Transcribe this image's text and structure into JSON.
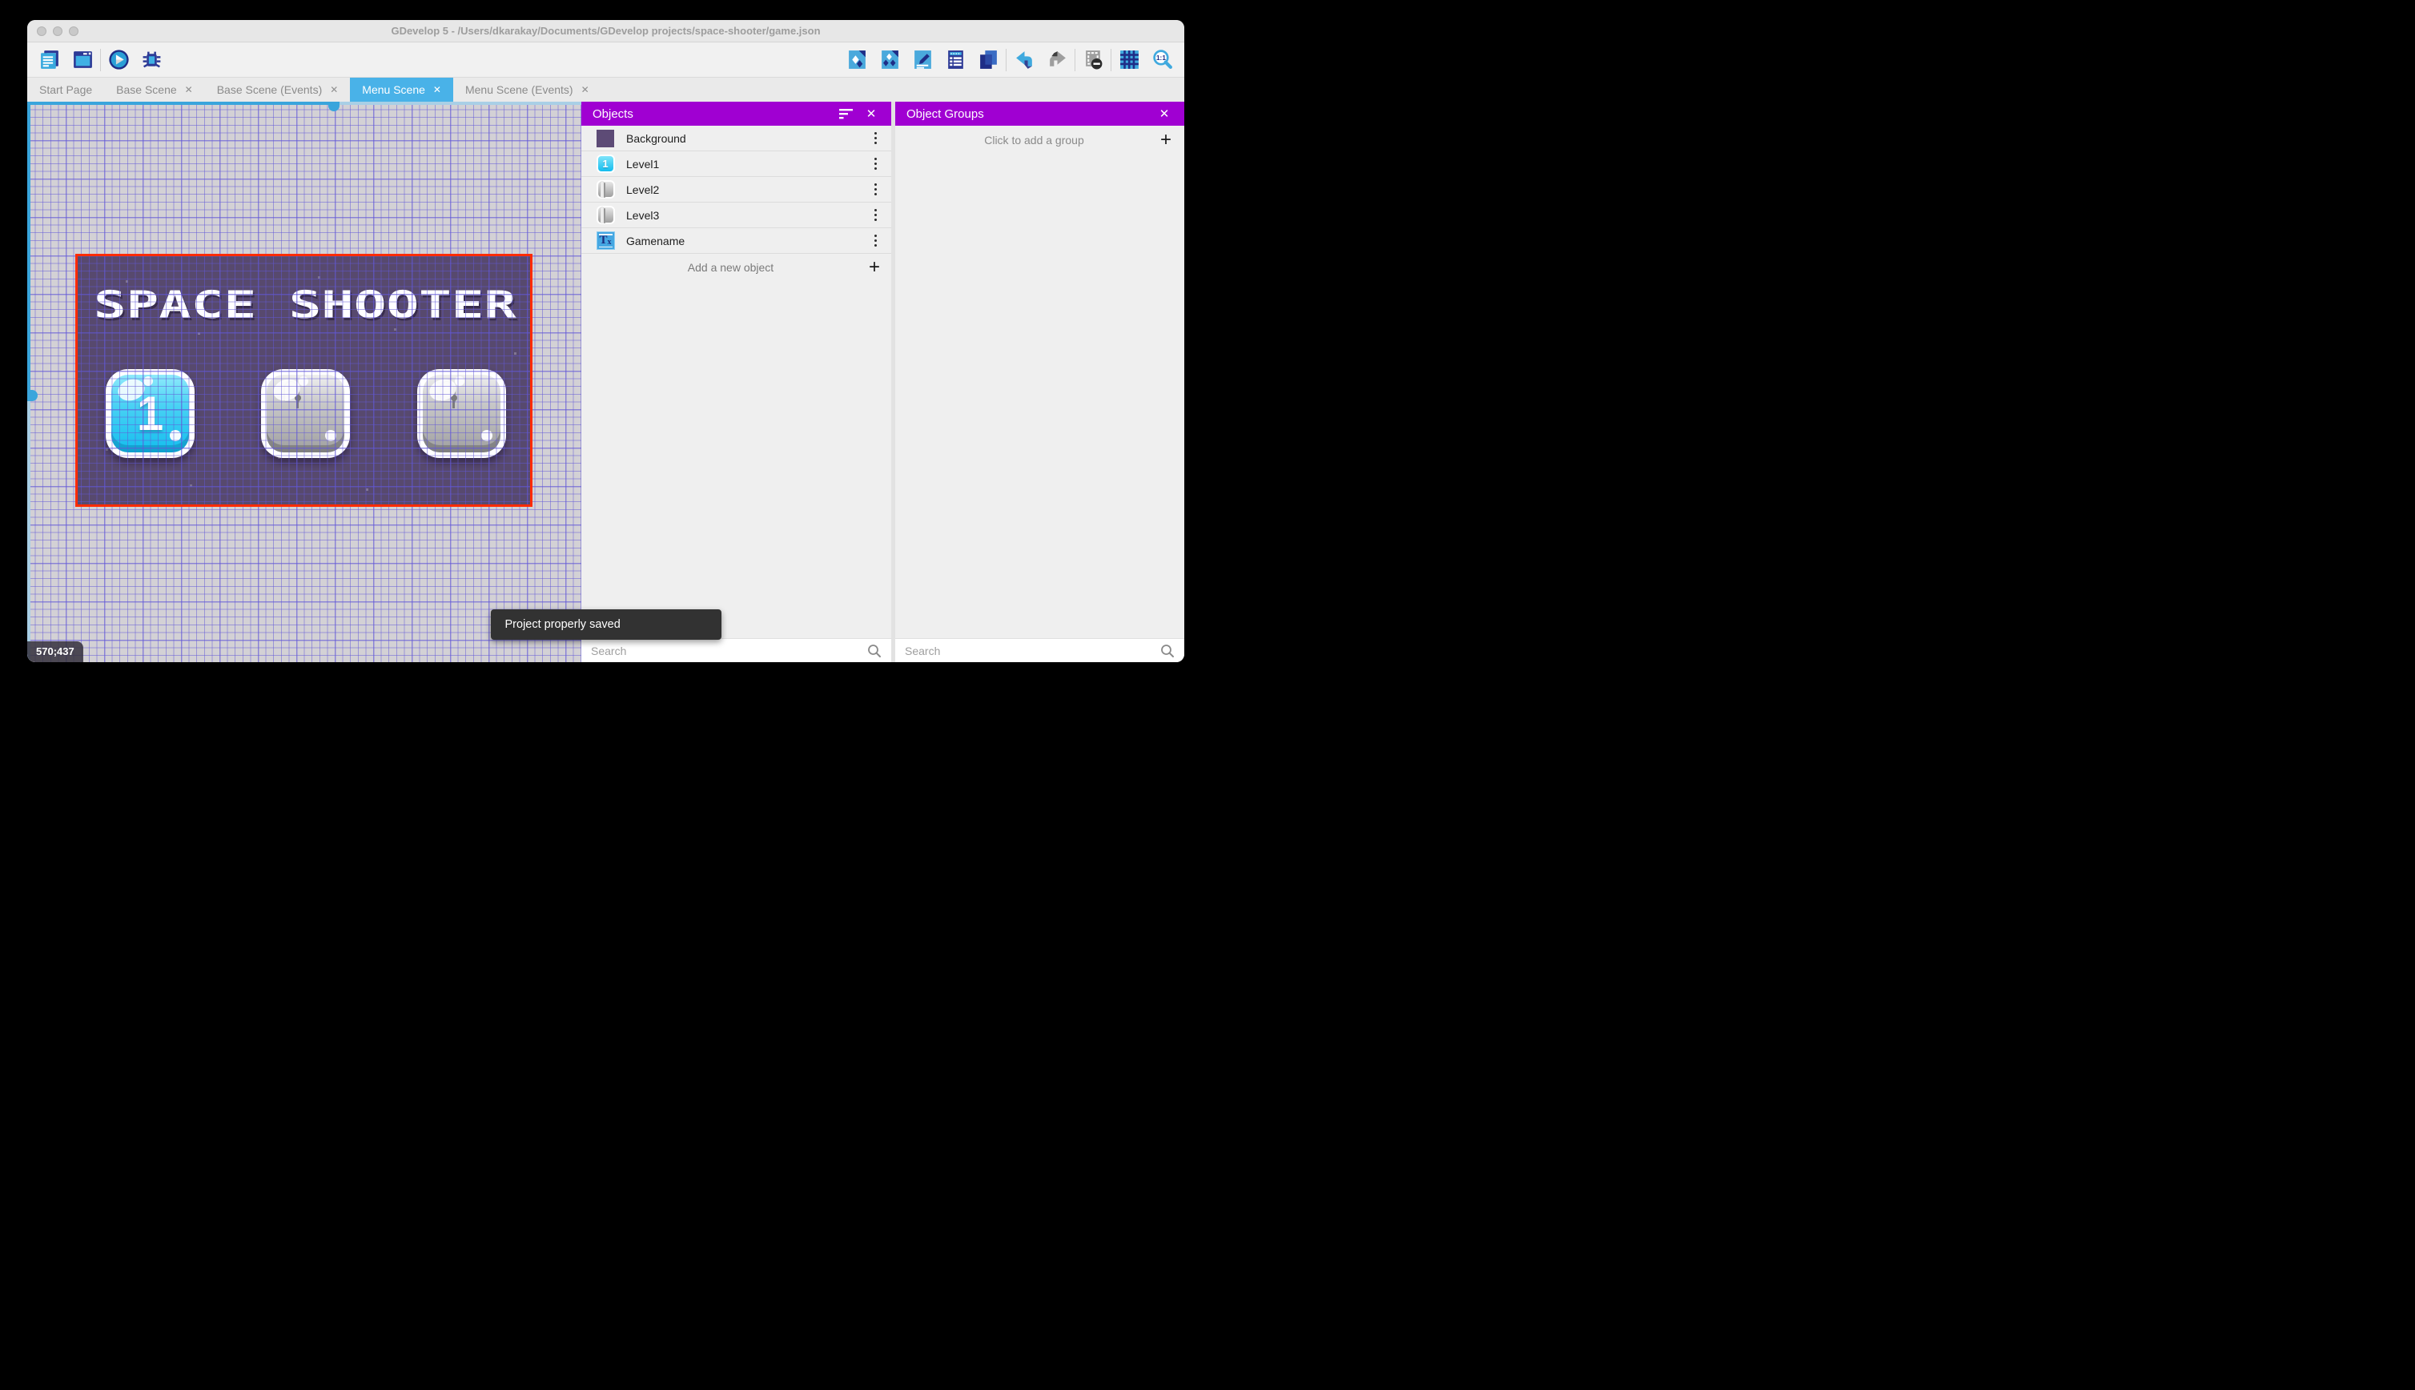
{
  "window": {
    "title": "GDevelop 5 - /Users/dkarakay/Documents/GDevelop projects/space-shooter/game.json"
  },
  "toolbar": {
    "left_icons": [
      "project-manager-icon",
      "start-page-icon",
      "play-icon",
      "debug-icon"
    ],
    "right_icons": [
      "add-object-icon",
      "object-groups-icon",
      "scene-properties-icon",
      "instances-list-icon",
      "layers-icon",
      "undo-icon",
      "redo-icon",
      "delete-instances-icon",
      "grid-icon",
      "zoom-icon"
    ],
    "zoom_label": "1:1"
  },
  "tabs": [
    {
      "label": "Start Page",
      "closable": false,
      "active": false
    },
    {
      "label": "Base Scene",
      "closable": true,
      "active": false
    },
    {
      "label": "Base Scene (Events)",
      "closable": true,
      "active": false
    },
    {
      "label": "Menu Scene",
      "closable": true,
      "active": true
    },
    {
      "label": "Menu Scene (Events)",
      "closable": true,
      "active": false
    }
  ],
  "canvas": {
    "cursor_coordinates": "570;437",
    "scene": {
      "title": "SPACE SHOOTER",
      "buttons": [
        {
          "name": "level-1",
          "label": "1",
          "state": "unlocked"
        },
        {
          "name": "level-2",
          "label": "",
          "state": "locked"
        },
        {
          "name": "level-3",
          "label": "",
          "state": "locked"
        }
      ]
    }
  },
  "objects_panel": {
    "title": "Objects",
    "items": [
      {
        "name": "Background",
        "thumb": "background-swatch"
      },
      {
        "name": "Level1",
        "thumb": "level-button",
        "thumb_label": "1"
      },
      {
        "name": "Level2",
        "thumb": "locked-button"
      },
      {
        "name": "Level3",
        "thumb": "locked-button"
      },
      {
        "name": "Gamename",
        "thumb": "text-object",
        "thumb_label_main": "T",
        "thumb_label_sub": "x"
      }
    ],
    "add_label": "Add a new object",
    "search_placeholder": "Search"
  },
  "groups_panel": {
    "title": "Object Groups",
    "empty_label": "Click to add a group",
    "search_placeholder": "Search"
  },
  "toast": {
    "message": "Project properly saved"
  },
  "colors": {
    "accent_purple": "#a000d2",
    "accent_blue": "#49b2e8",
    "selection_red": "#ff2b00",
    "scene_background": "#57496e",
    "toast_background": "#323232"
  }
}
